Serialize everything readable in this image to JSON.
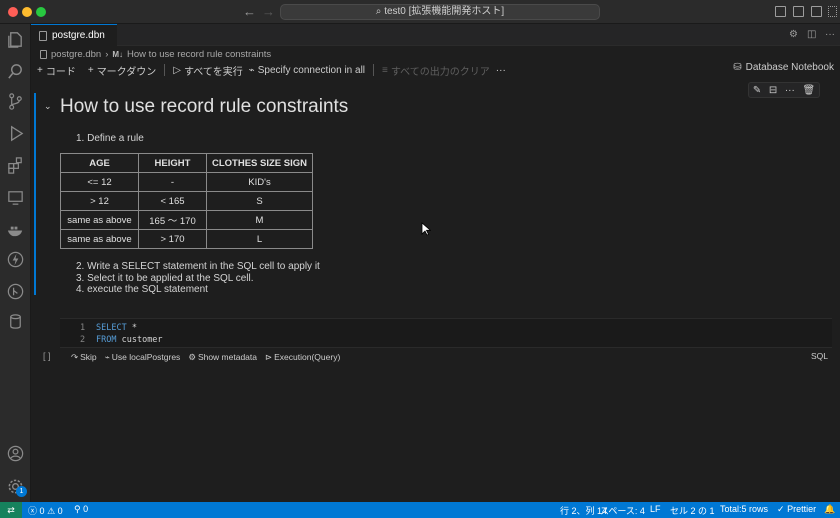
{
  "window": {
    "title": "test0 [拡張機能開発ホスト]"
  },
  "tab": {
    "label": "postgre.dbn"
  },
  "breadcrumb": {
    "file": "postgre.dbn",
    "md_tag": "M↓",
    "section": "How to use record rule constraints"
  },
  "toolbar": {
    "code": "コード",
    "markdown": "マークダウン",
    "run_all": "すべてを実行",
    "specify": "Specify connection in all",
    "clear_all": "すべての出力のクリア",
    "more": "···",
    "kernel": "Database Notebook"
  },
  "markdown_cell": {
    "heading": "How to use record rule constraints",
    "item1": "Define a rule",
    "item2": "Write a SELECT statement in the SQL cell to apply it",
    "item3": "Select it to be applied at the SQL cell.",
    "item4": "execute the SQL statement",
    "table": {
      "headers": [
        "AGE",
        "HEIGHT",
        "CLOTHES SIZE SIGN"
      ],
      "rows": [
        [
          "<= 12",
          "-",
          "KID's"
        ],
        [
          "> 12",
          "< 165",
          "S"
        ],
        [
          "same as above",
          "165 ～  170",
          "M"
        ],
        [
          "same as above",
          ">   170",
          "L"
        ]
      ]
    }
  },
  "code_cell": {
    "line1_num": "1",
    "line1_kw": "SELECT",
    "line1_rest": " *",
    "line2_num": "2",
    "line2_kw": "FROM",
    "line2_rest": " customer",
    "skip": "Skip",
    "use": "Use localPostgres",
    "metadata": "Show metadata",
    "execution": "Execution(Query)",
    "language": "SQL"
  },
  "statusbar": {
    "errors": "0",
    "warnings": "0",
    "ports": "0",
    "position": "行 2、列 14",
    "spaces": "スペース: 4",
    "eol": "LF",
    "cell": "セル 2 の 1",
    "total": "Total:5 rows",
    "prettier": "Prettier"
  },
  "activity": {
    "badge": "1"
  }
}
